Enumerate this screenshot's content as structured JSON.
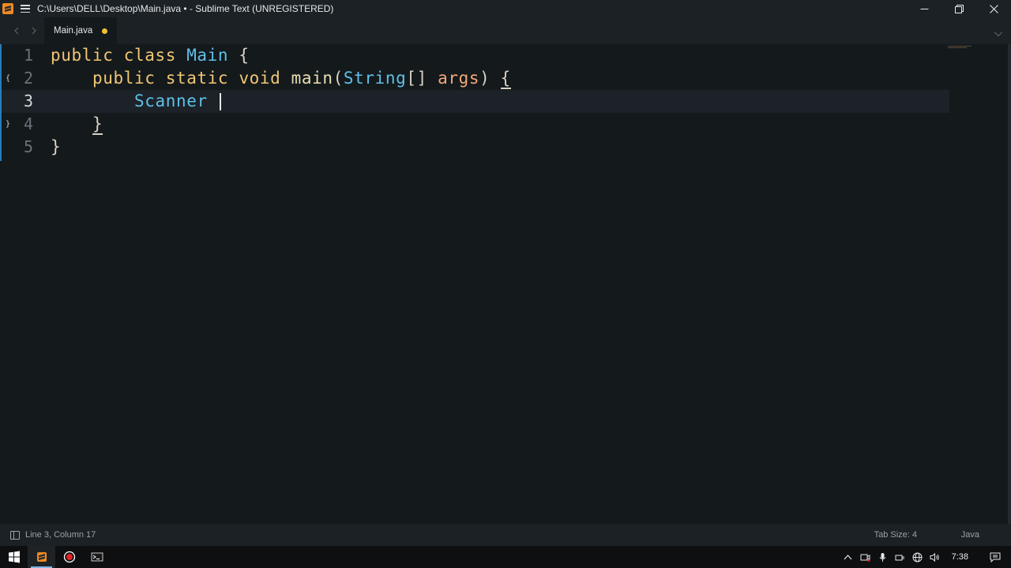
{
  "window": {
    "title": "C:\\Users\\DELL\\Desktop\\Main.java • - Sublime Text (UNREGISTERED)"
  },
  "tabs": [
    {
      "label": "Main.java",
      "dirty": true
    }
  ],
  "editor": {
    "lines": [
      {
        "number": "1"
      },
      {
        "number": "2"
      },
      {
        "number": "3"
      },
      {
        "number": "4"
      },
      {
        "number": "5"
      }
    ],
    "code": {
      "l1_kw1": "public",
      "l1_kw2": "class",
      "l1_cls": "Main",
      "l1_brace": "{",
      "l2_kw1": "public",
      "l2_kw2": "static",
      "l2_kw3": "void",
      "l2_fn": "main",
      "l2_open": "(",
      "l2_type": "String",
      "l2_arr": "[]",
      "l2_param": "args",
      "l2_close": ")",
      "l2_brace": "{",
      "l3_type": "Scanner",
      "l4_brace": "}",
      "l5_brace": "}"
    },
    "active_line": 3
  },
  "status": {
    "position": "Line 3, Column 17",
    "tab_size": "Tab Size: 4",
    "syntax": "Java"
  },
  "taskbar": {
    "clock": "7:38"
  },
  "colors": {
    "background": "#14191c",
    "chrome": "#1b2125",
    "keyword": "#f0c674",
    "type": "#5fc0e8",
    "param": "#f4a87a",
    "dirty_dot": "#f2c230"
  }
}
